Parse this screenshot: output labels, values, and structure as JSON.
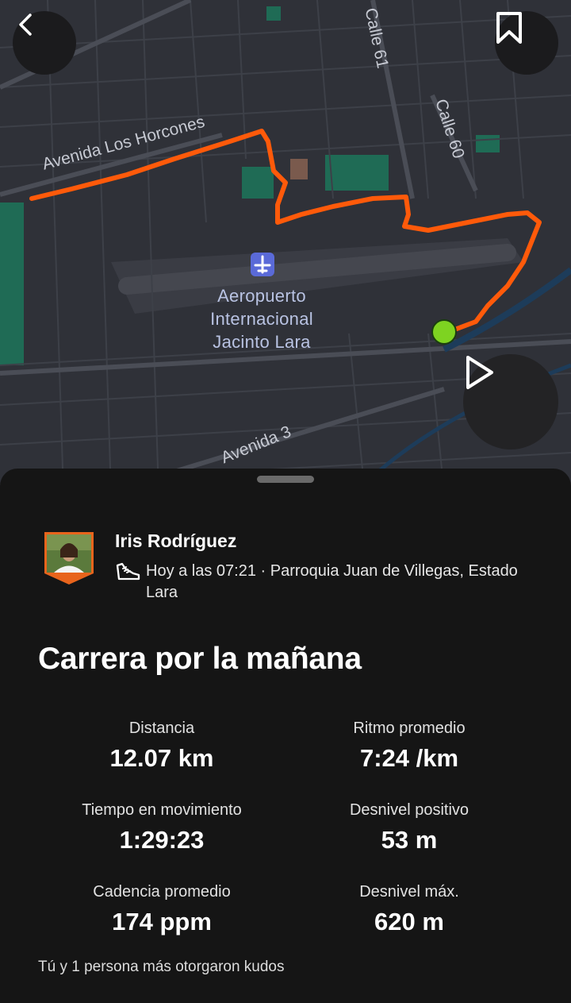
{
  "map": {
    "streets": {
      "avenida_los_horcones": "Avenida Los Horcones",
      "calle_61": "Calle 61",
      "calle_60": "Calle 60",
      "avenida_3": "Avenida 3"
    },
    "airport": {
      "line1": "Aeropuerto",
      "line2": "Internacional",
      "line3": "Jacinto Lara"
    },
    "route_color": "#ff5a0a",
    "end_marker_color": "#7ed321"
  },
  "controls": {
    "back_icon": "chevron-left-icon",
    "bookmark_icon": "bookmark-icon",
    "play_icon": "play-icon"
  },
  "activity": {
    "athlete_name": "Iris Rodríguez",
    "meta": "Hoy a las 07:21 · Parroquia Juan de Villegas, Estado Lara",
    "sport_icon": "running-shoe-icon",
    "title": "Carrera por la mañana",
    "stats": [
      {
        "label": "Distancia",
        "value": "12.07 km"
      },
      {
        "label": "Ritmo promedio",
        "value": "7:24 /km"
      },
      {
        "label": "Tiempo en movimiento",
        "value": "1:29:23"
      },
      {
        "label": "Desnivel positivo",
        "value": "53 m"
      },
      {
        "label": "Cadencia promedio",
        "value": "174 ppm"
      },
      {
        "label": "Desnivel máx.",
        "value": "620 m"
      }
    ],
    "kudos": "Tú y 1 persona más otorgaron kudos"
  },
  "colors": {
    "sheet_bg": "#151515",
    "map_bg": "#2e3037",
    "accent": "#fc4c02"
  }
}
